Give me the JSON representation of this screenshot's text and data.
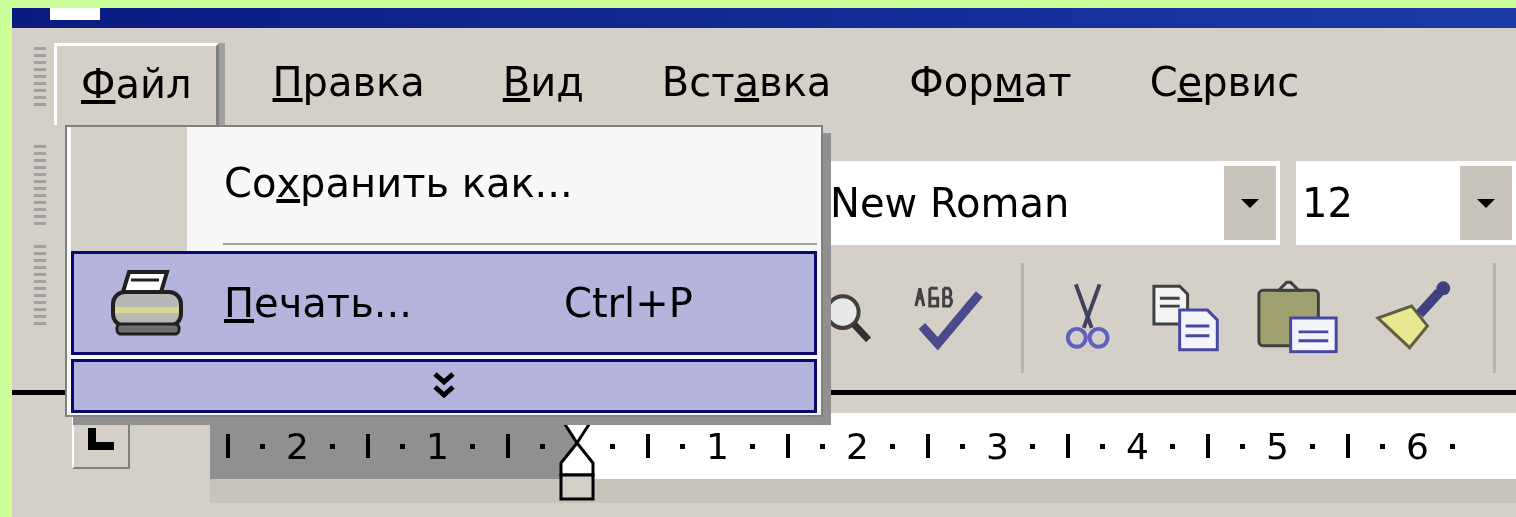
{
  "menu_bar": [
    {
      "key": "Ф",
      "after": "айл",
      "selected": true
    },
    {
      "key": "П",
      "after": "равка",
      "selected": false
    },
    {
      "key": "В",
      "after": "ид",
      "selected": false
    },
    {
      "before": "Вст",
      "key": "а",
      "after": "вка",
      "selected": false
    },
    {
      "before": "Фор",
      "key": "м",
      "after": "ат",
      "selected": false
    },
    {
      "before": "С",
      "key": "е",
      "after": "рвис",
      "selected": false
    }
  ],
  "file_menu": [
    {
      "kind": "command",
      "before": "Со",
      "key": "х",
      "after": "ранить как...",
      "selected": false
    },
    {
      "kind": "separator"
    },
    {
      "kind": "print",
      "key": "П",
      "after": "ечать...",
      "shortcut": "Ctrl+P",
      "selected": true
    },
    {
      "kind": "expand",
      "selected": true
    }
  ],
  "formatting_toolbar": {
    "font": "New Roman",
    "size": "12"
  },
  "ruler": {
    "left_numbers": [
      "2",
      "1"
    ],
    "right_numbers": [
      "1",
      "2",
      "3",
      "4",
      "5",
      "6"
    ]
  }
}
